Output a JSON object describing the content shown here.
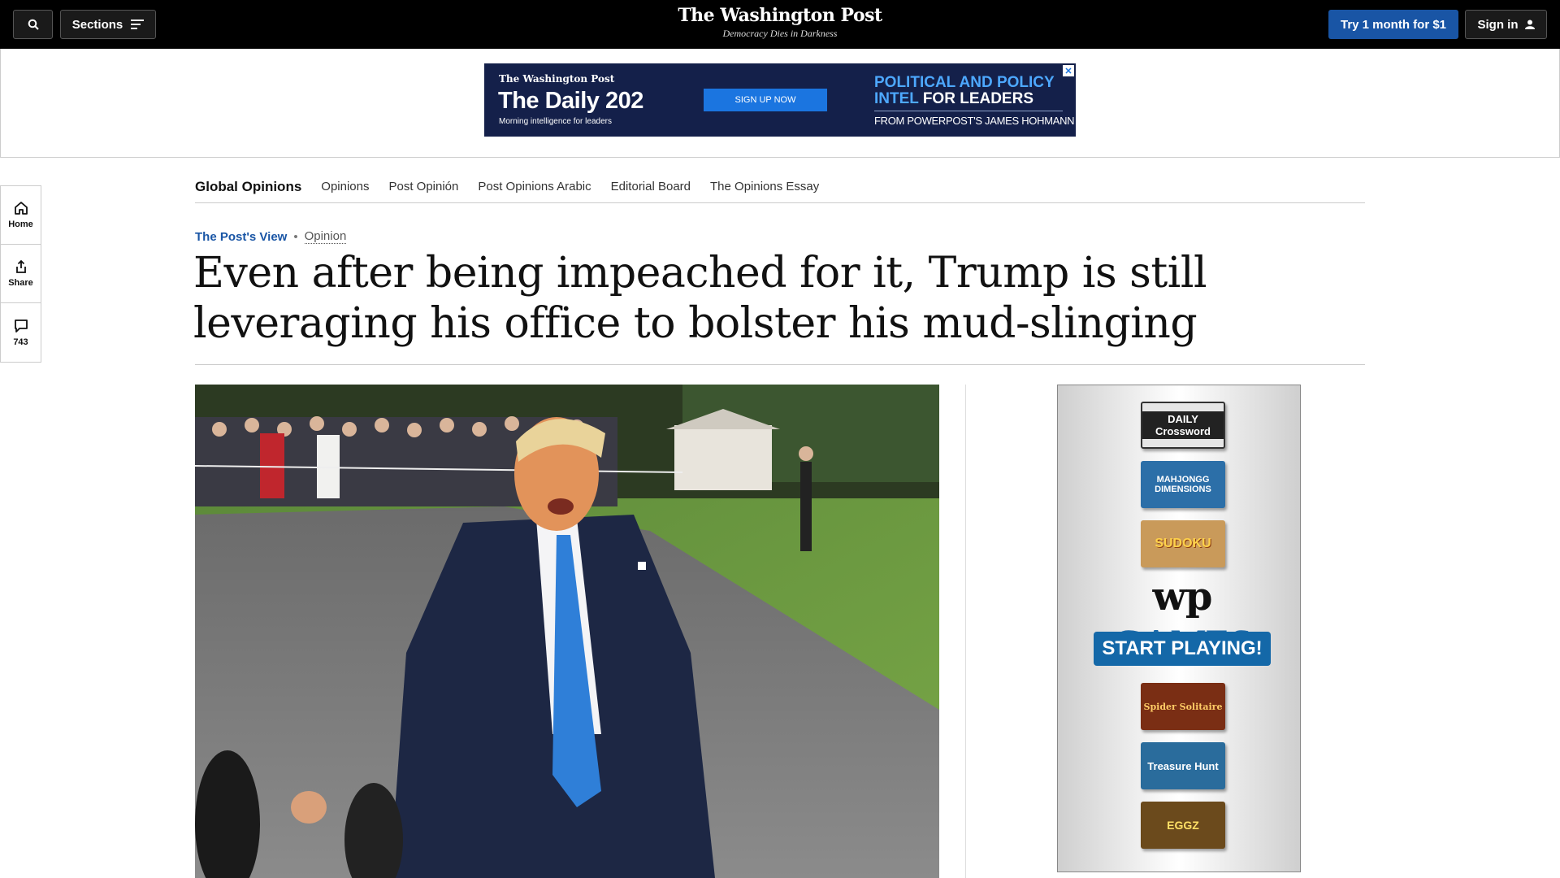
{
  "topbar": {
    "sections_label": "Sections",
    "masthead": "The Washington Post",
    "tagline": "Democracy Dies in Darkness",
    "try_label": "Try 1 month for $1",
    "signin_label": "Sign in"
  },
  "ad_banner": {
    "logo": "The Washington Post",
    "title": "The Daily 202",
    "subtitle": "Morning intelligence for leaders",
    "cta": "SIGN UP NOW",
    "headline_blue": "POLITICAL AND POLICY INTEL",
    "headline_white": "FOR LEADERS",
    "byline": "FROM POWERPOST'S JAMES HOHMANN",
    "close": "✕"
  },
  "rail": {
    "home_label": "Home",
    "share_label": "Share",
    "comments_count": "743"
  },
  "subnav": {
    "title": "Global Opinions",
    "links": [
      "Opinions",
      "Post Opinión",
      "Post Opinions Arabic",
      "Editorial Board",
      "The Opinions Essay"
    ]
  },
  "article": {
    "kicker_primary": "The Post's View",
    "kicker_secondary": "Opinion",
    "headline": "Even after being impeached for it, Trump is still leveraging his office to bolster his mud-slinging"
  },
  "games_ad": {
    "tiles": [
      "DAILY Crossword",
      "MAHJONGG DIMENSIONS",
      "SUDOKU",
      "Spider Solitaire",
      "Treasure Hunt",
      "EGGZ"
    ],
    "brand_wp": "wp",
    "brand_games": "GAMES",
    "cta": "START PLAYING!"
  },
  "colors": {
    "accent_blue": "#1955a5",
    "topbar": "#000000",
    "ad_navy": "#14204a"
  }
}
